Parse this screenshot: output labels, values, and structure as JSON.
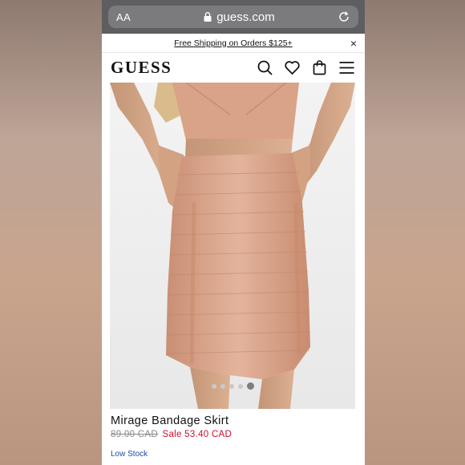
{
  "browser": {
    "text_size_label": "AA",
    "url": "guess.com"
  },
  "promo": {
    "text": "Free Shipping on Orders $125+",
    "close_symbol": "×"
  },
  "header": {
    "logo": "GUESS",
    "icons": [
      "search-icon",
      "heart-icon",
      "bag-icon",
      "menu-icon"
    ]
  },
  "product": {
    "image_count": 5,
    "active_image": 5,
    "name": "Mirage Bandage Skirt",
    "original_price": "89.00 CAD",
    "sale_price": "Sale 53.40 CAD",
    "stock_status": "Low Stock"
  },
  "colors": {
    "sale": "#c8102e",
    "stock": "#1f4aa8",
    "skirt": "#d9a68c"
  }
}
